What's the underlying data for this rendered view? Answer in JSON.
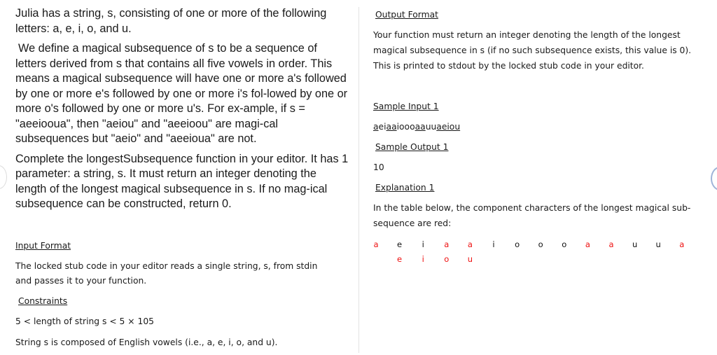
{
  "left": {
    "intro": "Julia has a string, s, consisting of one or more of the following letters: a, e, i, o, and u.",
    "definition": "We define a magical subsequence of s to be a sequence of letters derived from s that contains all five vowels in order. This means a magical subsequence will have one or more a's followed by one or more e's followed by one or more i's fol-lowed by one or more o's followed by one or more u's. For ex-ample, if s = \"aeeiooua\", then \"aeiou\" and \"aeeioou\" are magi-cal subsequences but \"aeio\" and \"aeeioua\" are not.",
    "task": "Complete the longestSubsequence function in your editor. It has 1 parameter: a string, s. It must return an integer denoting the length of the longest magical subsequence in s. If no mag-ical subsequence can be constructed, return 0.",
    "input_format_heading": "Input Format",
    "input_format_text_1": "The locked stub code in your editor reads a single string, s, from stdin",
    "input_format_text_2": "and passes it to your function.",
    "constraints_heading": "Constraints",
    "constraint_1": "5 < length of string s < 5 × 105",
    "constraint_2": "String s is composed of English vowels (i.e., a, e, i, o, and u)."
  },
  "right": {
    "output_format_heading": "Output Format",
    "output_format_lines": [
      "Your function must return an integer denoting the length of the longest",
      "magical subsequence in s (if no such subsequence exists, this value is 0).",
      "This is printed to stdout by the locked stub code in your editor."
    ],
    "sample_input_heading": "Sample Input 1",
    "sample_input_segments": [
      {
        "text": "a",
        "underline": true
      },
      {
        "text": "ei",
        "underline": false
      },
      {
        "text": "aa",
        "underline": true
      },
      {
        "text": "iooo",
        "underline": false
      },
      {
        "text": "aa",
        "underline": true
      },
      {
        "text": "uu",
        "underline": false
      },
      {
        "text": "aeiou",
        "underline": true
      }
    ],
    "sample_output_heading": "Sample Output 1",
    "sample_output_value": "10",
    "explanation_heading": "Explanation 1",
    "explanation_lines": [
      "In the table below, the component characters of the longest magical sub-",
      "sequence are red:"
    ],
    "explanation_row_1": [
      {
        "ch": "a",
        "red": true
      },
      {
        "ch": "e",
        "red": false
      },
      {
        "ch": "i",
        "red": false
      },
      {
        "ch": "a",
        "red": true
      },
      {
        "ch": "a",
        "red": true
      },
      {
        "ch": "i",
        "red": false
      },
      {
        "ch": "o",
        "red": false
      },
      {
        "ch": "o",
        "red": false
      },
      {
        "ch": "o",
        "red": false
      },
      {
        "ch": "a",
        "red": true
      },
      {
        "ch": "a",
        "red": true
      },
      {
        "ch": "u",
        "red": false
      },
      {
        "ch": "u",
        "red": false
      },
      {
        "ch": "a",
        "red": true
      }
    ],
    "explanation_row_2": [
      {
        "ch": "e",
        "red": true
      },
      {
        "ch": "i",
        "red": true
      },
      {
        "ch": "o",
        "red": true
      },
      {
        "ch": "u",
        "red": true
      }
    ]
  },
  "colors": {
    "highlight_red": "#ee1111",
    "text": "#1a1a1a",
    "divider": "#e2e2e2"
  }
}
